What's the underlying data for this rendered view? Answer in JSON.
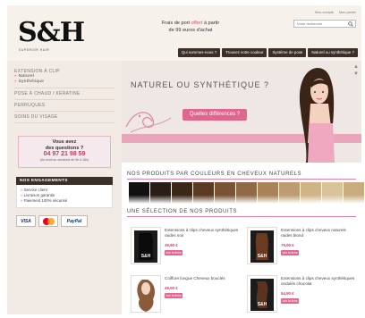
{
  "header": {
    "logo": "S&H",
    "logo_sub": "SUPERIOR HAIR",
    "shipping_line1_before": "Frais de port ",
    "shipping_accent": "offert",
    "shipping_line1_after": " à partir",
    "shipping_line2": "de 99 euros d'achat",
    "top_links": [
      "Mon compte",
      "Mon panier"
    ],
    "search_placeholder": "Votre recherche",
    "nav": [
      "Qui sommes-nous ?",
      "Trouvez votre couleur",
      "Système de pose",
      "Naturel ou synthétique ?"
    ]
  },
  "sidebar": {
    "menu": [
      {
        "label": "Extension à clip",
        "subs": [
          "Naturel",
          "Synthétique"
        ]
      },
      {
        "label": "Pose à chaud / kératine",
        "subs": []
      },
      {
        "label": "Perruques",
        "subs": []
      },
      {
        "label": "Soins du visage",
        "subs": []
      }
    ],
    "contact": {
      "line1": "Vous avez",
      "line2": "des questions ?",
      "phone": "04 97 21 98 59",
      "hours": "(du lundi au vendredi de 9h à 18h)"
    },
    "engagements": {
      "title": "NOS ENGAGEMENTS",
      "items": [
        "Service client",
        "Livraison garantie",
        "Paiement 100% sécurisé"
      ]
    },
    "payments": [
      "VISA",
      "MasterCard",
      "PayPal"
    ]
  },
  "banner": {
    "title": "NATUREL OU SYNTHÉTIQUE ?",
    "button": "Quelles différences ?"
  },
  "colors_section": {
    "title": "Nos produits par couleurs en cheveux naturels",
    "swatches": [
      "#111111",
      "#2a1c16",
      "#3b2718",
      "#5a3a24",
      "#7a5234",
      "#8f6a48",
      "#a98259",
      "#bd9c72",
      "#cfb488",
      "#d9c39a",
      "#c8ac7e"
    ]
  },
  "products_section": {
    "title": "Une sélection de nos produits",
    "button_label": "Voir la fiche",
    "items": [
      {
        "name": "Extensions à clips cheveux synthétiques raides noir",
        "price": "39,90 €"
      },
      {
        "name": "Extensions à clips cheveux naturels raides blond",
        "price": "79,00 €"
      },
      {
        "name": "Coiffure longue Cheveux bouclés",
        "price": "49,00 €"
      },
      {
        "name": "Extensions à clips cheveux synthétiques ondulés chocolat",
        "price": "54,90 €"
      }
    ]
  },
  "colors": {
    "accent": "#e0457b",
    "nav_bg": "#3b2f2a",
    "banner_pink": "#e9a5ba"
  }
}
